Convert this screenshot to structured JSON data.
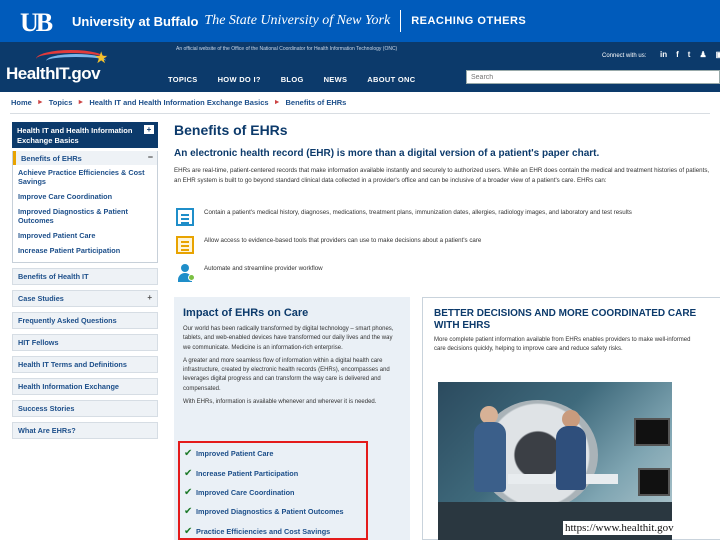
{
  "ub_banner": {
    "logo": "UB",
    "name": "University at Buffalo",
    "subtitle": "The State University of New York",
    "tagline": "REACHING OTHERS"
  },
  "header": {
    "logo_text": "HealthIT.gov",
    "official_notice": "An official website of the Office of the National Coordinator for Health Information Technology (ONC)",
    "connect_label": "Connect with us:",
    "social": [
      "in",
      "f",
      "t",
      "♟",
      "▣"
    ],
    "nav": [
      "TOPICS",
      "HOW DO I?",
      "BLOG",
      "NEWS",
      "ABOUT ONC"
    ],
    "search_placeholder": "Search"
  },
  "breadcrumb": [
    "Home",
    "Topics",
    "Health IT and Health Information Exchange Basics",
    "Benefits of EHRs"
  ],
  "sidebar": {
    "header": "Health IT and Health Information Exchange Basics",
    "header_toggle": "+",
    "current": "Benefits of EHRs",
    "current_toggle": "−",
    "children": [
      "Achieve Practice Efficiencies & Cost Savings",
      "Improve Care Coordination",
      "Improved Diagnostics & Patient Outcomes",
      "Improved Patient Care",
      "Increase Patient Participation"
    ],
    "items": [
      {
        "label": "Benefits of Health IT",
        "toggle": ""
      },
      {
        "label": "Case Studies",
        "toggle": "+"
      },
      {
        "label": "Frequently Asked Questions",
        "toggle": ""
      },
      {
        "label": "HIT Fellows",
        "toggle": ""
      },
      {
        "label": "Health IT Terms and Definitions",
        "toggle": ""
      },
      {
        "label": "Health Information Exchange",
        "toggle": ""
      },
      {
        "label": "Success Stories",
        "toggle": ""
      },
      {
        "label": "What Are EHRs?",
        "toggle": ""
      }
    ]
  },
  "main": {
    "title": "Benefits of EHRs",
    "lead": "An electronic health record (EHR) is more than a digital version of a patient's paper chart.",
    "intro": "EHRs are real-time, patient-centered records that make information available instantly and securely to authorized users. While an EHR does contain the medical and treatment histories of patients, an EHR system is built to go beyond standard clinical data collected in a provider's office and can be inclusive of a broader view of a patient's care. EHRs can:",
    "bullets": [
      {
        "icon": "document-icon",
        "text": "Contain a patient's medical history, diagnoses, medications, treatment plans, immunization dates, allergies, radiology images, and laboratory and test results"
      },
      {
        "icon": "clipboard-icon",
        "text": "Allow access to evidence-based tools that providers can use to make decisions about a patient's care"
      },
      {
        "icon": "person-gear-icon",
        "text": "Automate and streamline provider workflow"
      }
    ]
  },
  "impact": {
    "title": "Impact of EHRs on Care",
    "paragraphs": [
      "Our world has been radically transformed by digital technology – smart phones, tablets, and web-enabled devices have transformed our daily lives and the way we communicate. Medicine is an information-rich enterprise.",
      "A greater and more seamless flow of information within a digital health care infrastructure, created by electronic health records (EHRs), encompasses and leverages digital progress and can transform the way care is delivered and compensated.",
      "With EHRs, information is available whenever and wherever it is needed."
    ],
    "checklist": [
      "Improved Patient Care",
      "Increase Patient Participation",
      "Improved Care Coordination",
      "Improved Diagnostics & Patient Outcomes",
      "Practice Efficiencies and Cost Savings"
    ]
  },
  "better": {
    "title": "BETTER DECISIONS AND MORE COORDINATED CARE WITH EHRS",
    "text": "More complete patient information available from EHRs enables providers to make well-informed care decisions quickly, helping to improve care and reduce safety risks."
  },
  "credit": "https://www.healthit.gov",
  "colors": {
    "ub_blue": "#005bbb",
    "hit_navy": "#0c3a6b",
    "highlight_red": "#e41b1b",
    "check_green": "#1d7a2a"
  }
}
